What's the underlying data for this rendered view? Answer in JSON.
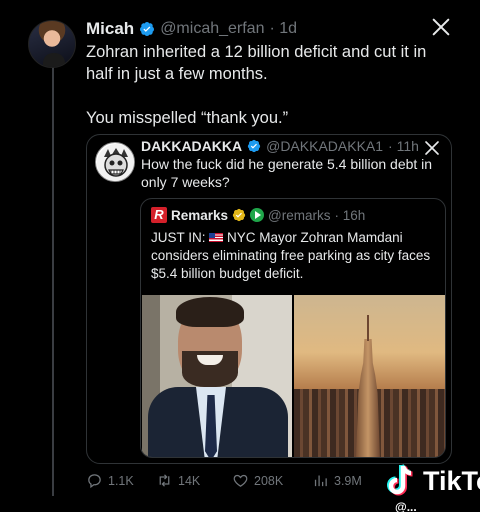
{
  "tweet": {
    "author_name": "Micah",
    "author_handle": "@micah_erfan",
    "time": "· 1d",
    "text_line1": "Zohran inherited a 12 billion deficit and cut it in half in just a few months.",
    "text_line2": "You misspelled “thank you.”"
  },
  "quote": {
    "author_name": "DAKKADAKKA",
    "author_handle": "@DAKKADAKKA1",
    "time": "· 11h",
    "text": "How the fuck did he generate 5.4 billion debt in only 7 weeks?"
  },
  "nested_quote": {
    "logo_letter": "R",
    "author_name": "Remarks",
    "author_handle": "@remarks",
    "time": "· 16h",
    "text_prefix": "JUST IN:",
    "text_body": "NYC Mayor Zohran Mamdani considers eliminating free parking as city faces $5.4 billion budget deficit."
  },
  "actions": {
    "replies": "1.1K",
    "retweets": "14K",
    "likes": "208K",
    "views": "3.9M"
  },
  "overlay": {
    "tiktok_label": "TikTo",
    "tiktok_sub": "@..."
  },
  "icons": {
    "verified": "verified-badge-icon",
    "close": "close-x-icon",
    "reply": "reply-icon",
    "retweet": "retweet-icon",
    "like": "heart-icon",
    "views": "views-bar-icon"
  },
  "colors": {
    "background": "#000000",
    "text": "#e7e9ea",
    "muted": "#71767b",
    "verified_blue": "#1d9bf0",
    "border": "#2f3336"
  }
}
